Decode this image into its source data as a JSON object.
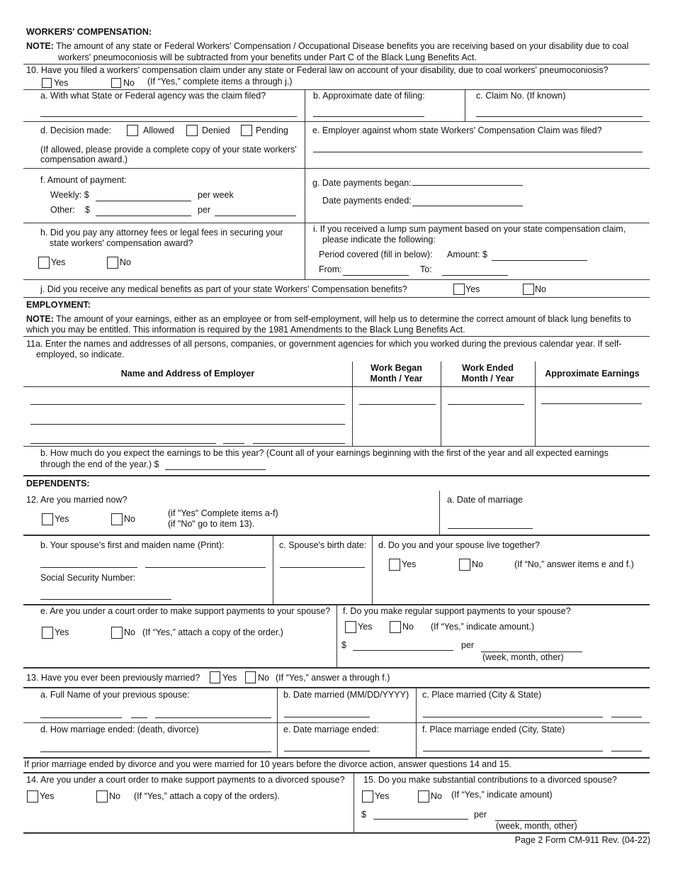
{
  "workers_comp": {
    "heading": "WORKERS' COMPENSATION:",
    "note_label": "NOTE:",
    "note_line1": "The amount of any state or Federal Workers' Compensation / Occupational Disease benefits you are receiving based on your disability due to coal",
    "note_line2": "workers' pneumoconiosis will be subtracted from your benefits under Part C of the Black Lung Benefits Act.",
    "q10": {
      "question": "10. Have you filed a workers' compensation claim under any state or Federal law on account of your disability, due to coal workers' pneumoconiosis?",
      "yes": "Yes",
      "no": "No",
      "hint": "(If “Yes,” complete items a through j.)",
      "a": "a. With what State or Federal agency was the claim filed?",
      "b": "b. Approximate date of filing:",
      "c": "c. Claim No. (If known)",
      "d": "d. Decision made:",
      "d_allowed": "Allowed",
      "d_denied": "Denied",
      "d_pending": "Pending",
      "d_note1": "(If allowed, please provide a complete copy of your state workers'",
      "d_note2": "compensation award.)",
      "e": "e. Employer against whom state Workers' Compensation Claim was filed?",
      "f": "f. Amount of payment:",
      "f_weekly": "Weekly: $",
      "f_per_week": "per week",
      "f_other": "Other:",
      "f_dollar": "$",
      "f_per": "per",
      "g_began": "g. Date payments began:",
      "g_ended": "Date payments ended:",
      "h1": "h. Did you pay any attorney fees or legal fees in securing your",
      "h2": "state workers' compensation award?",
      "h_yes": "Yes",
      "h_no": "No",
      "i1": "i. If you received a lump sum payment based on your state compensation claim,",
      "i2": "please indicate the following:",
      "i_period": "Period covered (fill in below):",
      "i_amount": "Amount: $",
      "i_from": "From:",
      "i_to": "To:",
      "j": "j. Did you receive any medical benefits as part of your state Workers' Compensation benefits?",
      "j_yes": "Yes",
      "j_no": "No"
    }
  },
  "employment": {
    "heading": "EMPLOYMENT:",
    "note_label": "NOTE:",
    "note_line1": "The amount of your earnings, either as an employee or from self-employment, will help us to determine the correct amount of black lung benefits to",
    "note_line2": "which you may be entitled. This information is required by the 1981 Amendments to the Black Lung Benefits Act.",
    "q11a_line1": "11a. Enter the names and addresses of all persons, companies, or government agencies for which you worked during the previous calendar year. If self-",
    "q11a_line2": "employed, so indicate.",
    "columns": [
      "Name and Address of Employer",
      "Work Began",
      "Month / Year",
      "Work Ended",
      "Month / Year",
      "Approximate Earnings"
    ],
    "q11b_line1": "b. How much do you expect the earnings to be this year?  (Count all of your earnings beginning with the first of the year and all expected earnings",
    "q11b_line2": "through the end of the year.)  $"
  },
  "dependents": {
    "heading": "DEPENDENTS:",
    "q12": "12. Are you married now?",
    "q12_yes": "Yes",
    "q12_no": "No",
    "q12_hint1": "(if \"Yes\" Complete items a-f)",
    "q12_hint2": "(if \"No\" go to item 13).",
    "q12a": "a. Date of marriage",
    "q12b": "b. Your spouse's first and maiden name (Print):",
    "q12b_ssn": "Social Security Number:",
    "q12c": "c. Spouse's birth date:",
    "q12d": "d. Do you and your spouse live together?",
    "q12d_yes": "Yes",
    "q12d_no": "No",
    "q12d_hint": "(If “No,” answer items e and f.)",
    "q12e": "e. Are you under a court order to make support payments to your spouse?",
    "q12e_yes": "Yes",
    "q12e_no": "No",
    "q12e_hint": "(If “Yes,” attach a copy of the order.)",
    "q12f": "f. Do you make regular support payments to your spouse?",
    "q12f_yes": "Yes",
    "q12f_no": "No",
    "q12f_hint": "(If “Yes,” indicate amount.)",
    "q12f_dollar": "$",
    "q12f_per": "per",
    "q12f_period": "(week, month, other)",
    "q13": "13. Have you ever been previously married?",
    "q13_yes": "Yes",
    "q13_no": "No",
    "q13_hint": "(If “Yes,” answer a through f.)",
    "q13a": "a. Full Name of your previous spouse:",
    "q13b": "b. Date married (MM/DD/YYYY)",
    "q13c": "c. Place married (City & State)",
    "q13d": "d. How marriage ended: (death, divorce)",
    "q13e": "e. Date marriage ended:",
    "q13f": "f. Place marriage ended (City, State)",
    "divorce_note": "If prior marriage ended by divorce and you were married for 10 years before the divorce action, answer questions 14 and 15.",
    "q14": "14.  Are you under a court order to make support payments to a divorced spouse?",
    "q14_yes": "Yes",
    "q14_no": "No",
    "q14_hint": "(If “Yes,” attach a copy of the orders).",
    "q15": "15.  Do you make substantial contributions to a divorced spouse?",
    "q15_yes": "Yes",
    "q15_no": "No",
    "q15_hint": "(If “Yes,” indicate amount)",
    "q15_dollar": "$",
    "q15_per": "per",
    "q15_period": "(week, month, other)"
  },
  "footer": "Page 2 Form CM-911 Rev. (04-22)"
}
